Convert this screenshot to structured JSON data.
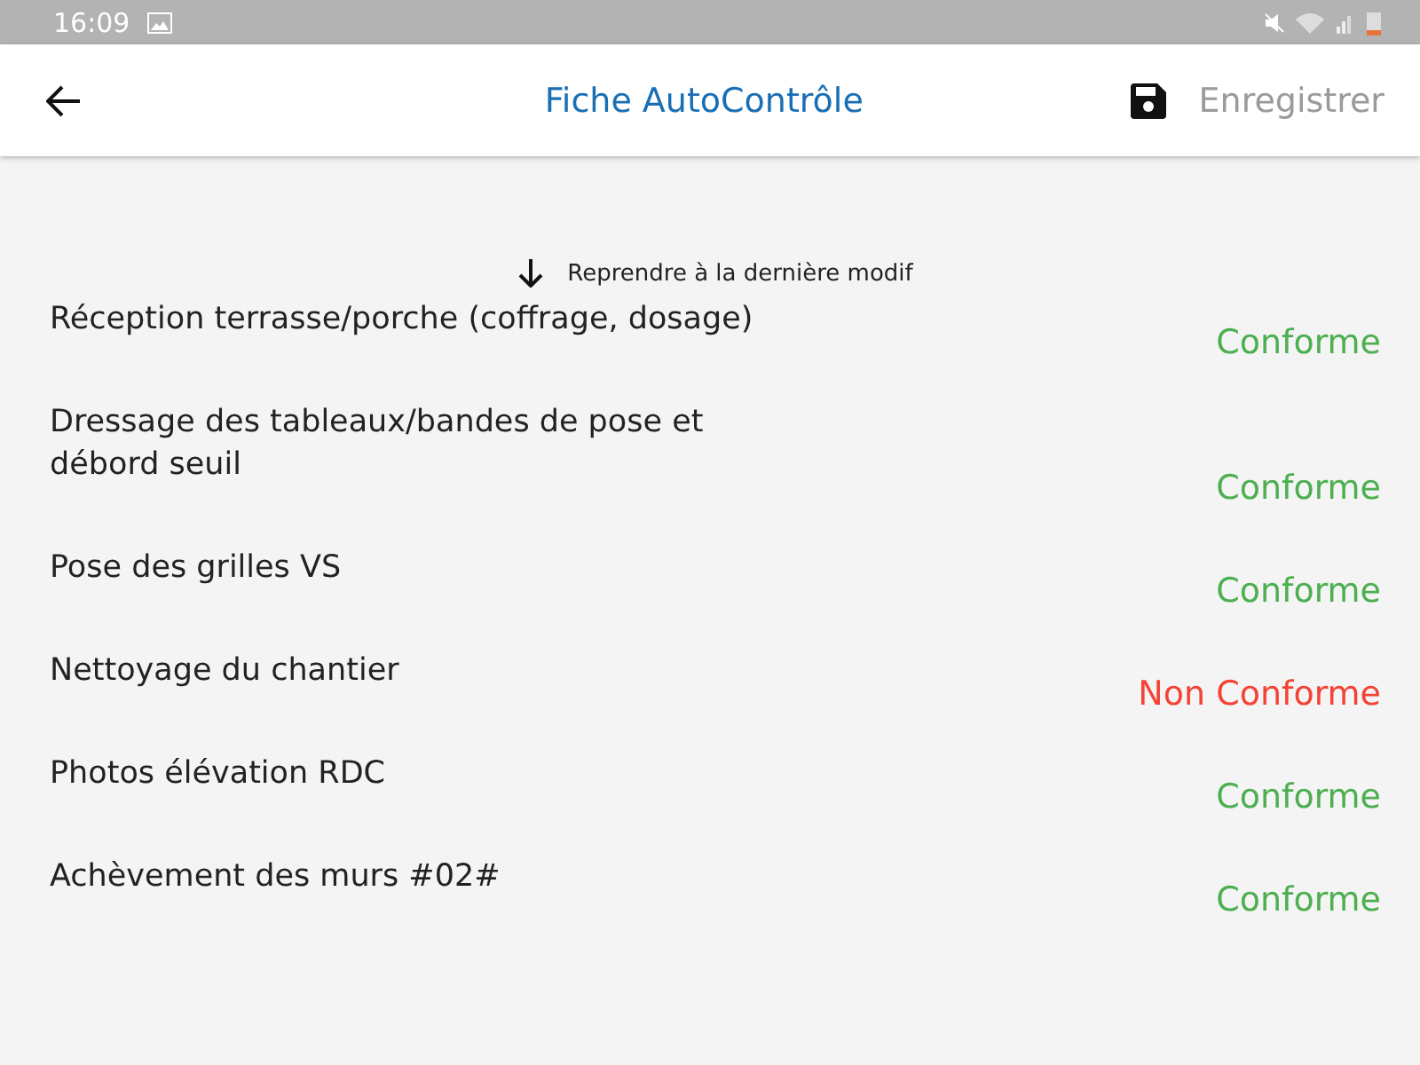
{
  "status_bar": {
    "time": "16:09"
  },
  "app_bar": {
    "title": "Fiche AutoContrôle",
    "save": {
      "label": "Enregistrer",
      "disabled": true
    }
  },
  "resume": {
    "label": "Reprendre à la dernière modif"
  },
  "items": [
    {
      "label": "Réception terrasse/porche (coffrage, dosage)",
      "status": "Conforme",
      "conforme": true
    },
    {
      "label": "Dressage des tableaux/bandes de pose et débord seuil",
      "status": "Conforme",
      "conforme": true
    },
    {
      "label": "Pose des grilles VS",
      "status": "Conforme",
      "conforme": true
    },
    {
      "label": "Nettoyage du chantier",
      "status": "Non Conforme",
      "conforme": false
    },
    {
      "label": "Photos élévation RDC",
      "status": "Conforme",
      "conforme": true
    },
    {
      "label": "Achèvement des murs #02#",
      "status": "Conforme",
      "conforme": true
    }
  ]
}
